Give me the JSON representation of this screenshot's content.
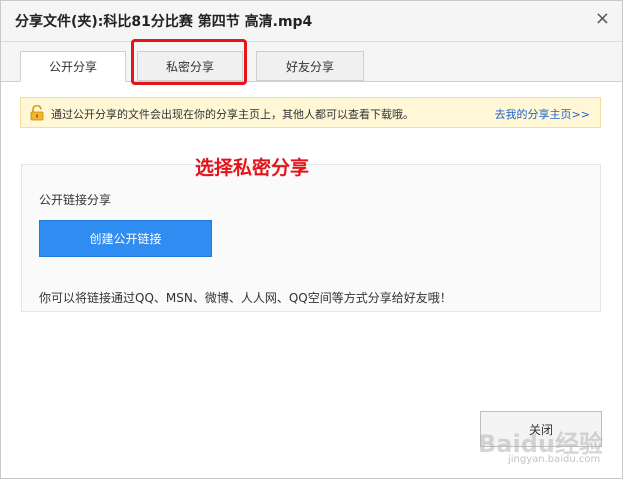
{
  "dialog": {
    "title": "分享文件(夹):科比81分比赛 第四节 高清.mp4",
    "close_icon": "×"
  },
  "tabs": [
    {
      "label": "公开分享",
      "active": true
    },
    {
      "label": "私密分享",
      "active": false
    },
    {
      "label": "好友分享",
      "active": false
    }
  ],
  "notice": {
    "icon": "lock-icon",
    "text": "通过公开分享的文件会出现在你的分享主页上，其他人都可以查看下载哦。",
    "link": "去我的分享主页>>"
  },
  "annotation": {
    "text": "选择私密分享",
    "color": "#e4141b"
  },
  "panel": {
    "heading": "公开链接分享",
    "create_button": "创建公开链接",
    "description": "你可以将链接通过QQ、MSN、微博、人人网、QQ空间等方式分享给好友哦！"
  },
  "footer": {
    "close_button": "关闭"
  },
  "watermark": {
    "main": "Baidu经验",
    "sub": "jingyan.baidu.com"
  },
  "colors": {
    "accent_button": "#2f8cf0",
    "highlight_red": "#e4141b",
    "notice_bg": "#fff7d6",
    "link": "#1a64c8"
  }
}
